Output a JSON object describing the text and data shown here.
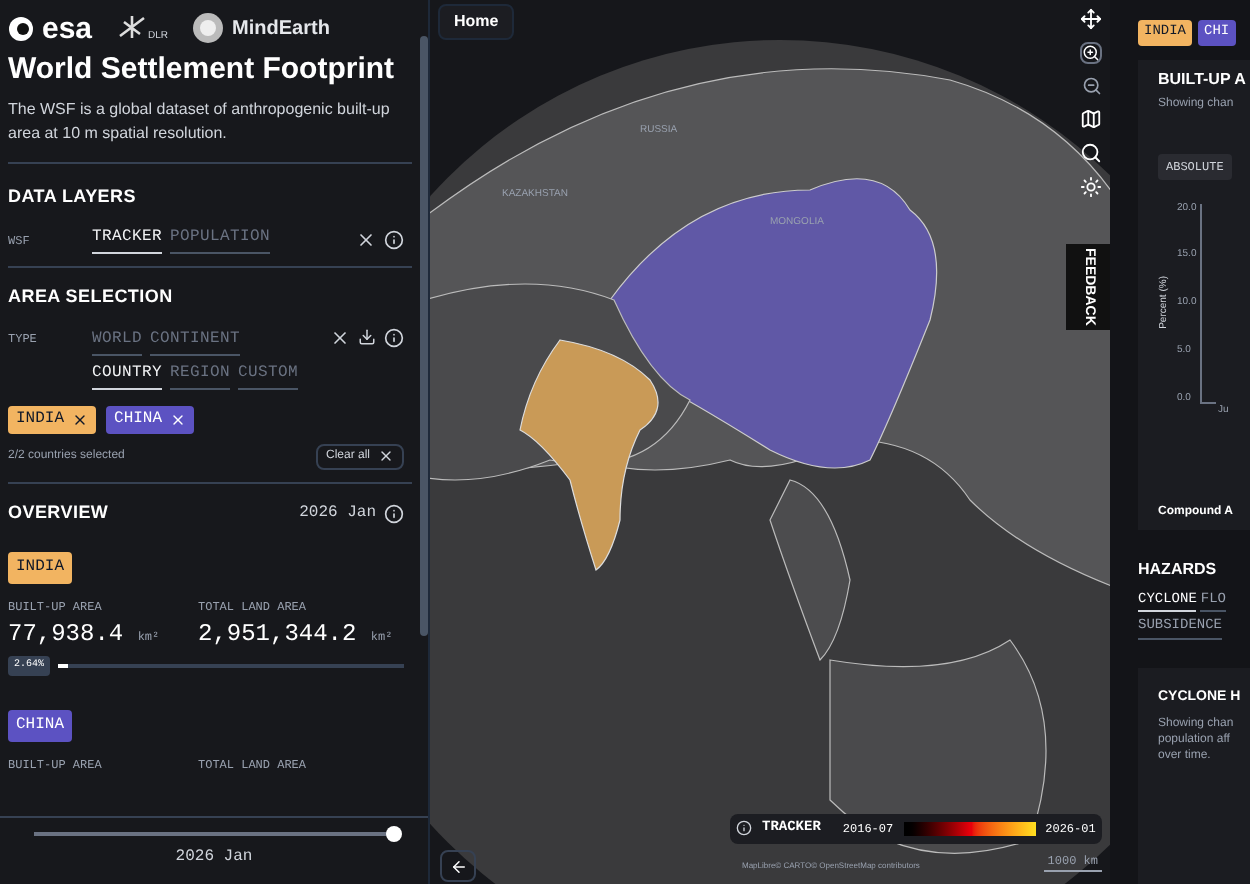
{
  "header": {
    "logos": [
      {
        "kind": "esa",
        "text": "esa"
      },
      {
        "kind": "dlr",
        "text": "DLR"
      },
      {
        "kind": "mindearth",
        "text": "MindEarth"
      }
    ]
  },
  "title": "World Settlement Footprint",
  "description": "The WSF is a global dataset of anthropogenic built-up area at 10 m spatial resolution.",
  "data_layers": {
    "heading": "DATA LAYERS",
    "label": "WSF",
    "options": [
      {
        "label": "TRACKER",
        "selected": true
      },
      {
        "label": "POPULATION",
        "selected": false
      }
    ]
  },
  "area_selection": {
    "heading": "AREA SELECTION",
    "label": "TYPE",
    "option_rows": [
      [
        {
          "label": "WORLD",
          "selected": false
        },
        {
          "label": "CONTINENT",
          "selected": false
        }
      ],
      [
        {
          "label": "COUNTRY",
          "selected": true
        },
        {
          "label": "REGION",
          "selected": false
        },
        {
          "label": "CUSTOM",
          "selected": false
        }
      ]
    ],
    "chips": [
      {
        "label": "INDIA",
        "color": "#f2b461"
      },
      {
        "label": "CHINA",
        "color": "#5c52c2"
      }
    ],
    "count": "2/2 countries selected",
    "clear": "Clear all"
  },
  "overview": {
    "heading": "OVERVIEW",
    "date": "2026 Jan",
    "countries": [
      {
        "name": "INDIA",
        "color": "#f2b461",
        "built_label": "BUILT-UP AREA",
        "built_value": "77,938.4",
        "built_unit": "km²",
        "total_label": "TOTAL LAND AREA",
        "total_value": "2,951,344.2",
        "total_unit": "km²",
        "percent": "2.64%",
        "level": 0.0264
      },
      {
        "name": "CHINA",
        "color": "#5c52c2",
        "built_label": "BUILT-UP AREA",
        "total_label": "TOTAL LAND AREA"
      }
    ]
  },
  "time_slider": {
    "level": 1,
    "label": "2026 Jan"
  },
  "map": {
    "home": "Home",
    "labels": [
      "RUSSIA",
      "KAZAKHSTAN",
      "MONGOLIA"
    ],
    "feedback": "FEEDBACK",
    "legend": {
      "layer": "TRACKER",
      "start": "2016-07",
      "end": "2026-01"
    },
    "attribution": "MapLibre© CARTO© OpenStreetMap contributors",
    "scale": "1000 km"
  },
  "right_panel": {
    "chips": [
      {
        "label": "INDIA",
        "color": "#f2b461"
      },
      {
        "label": "CHI",
        "color": "#5c52c2"
      }
    ],
    "card_title": "BUILT-UP A",
    "card_text": "Showing chan",
    "toggle": "ABSOLUTE",
    "y_label": "Percent (%)",
    "y_ticks": [
      "20.0",
      "15.0",
      "10.0",
      "5.0",
      "0.0"
    ],
    "x_tick": "Ju",
    "footer": "Compound A",
    "hazards": {
      "heading": "HAZARDS",
      "tab_rows": [
        [
          {
            "label": "CYCLONE",
            "selected": true
          },
          {
            "label": "FLO",
            "selected": false
          }
        ],
        [
          {
            "label": "SUBSIDENCE",
            "selected": false
          }
        ]
      ],
      "card_title": "CYCLONE H",
      "card_text": "Showing chan population aff over time."
    }
  }
}
